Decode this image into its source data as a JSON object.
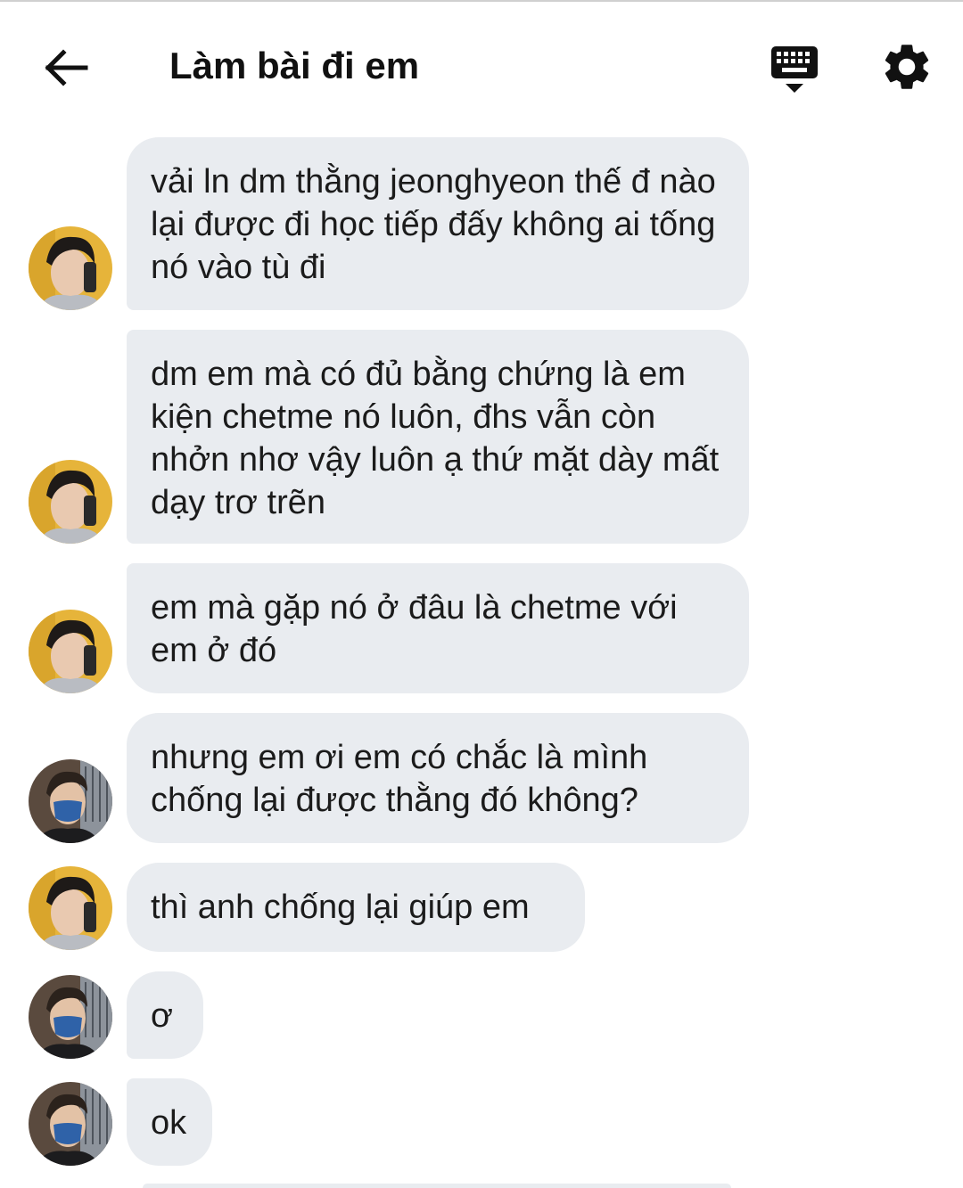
{
  "header": {
    "title": "Làm bài đi em",
    "back_icon": "arrow-left-icon",
    "keyboard_icon": "keyboard-icon",
    "settings_icon": "gear-icon"
  },
  "messages": [
    {
      "sender": "A",
      "text": "vải ln dm thằng jeonghyeon thế đ nào lại được đi học tiếp đấy không ai tống nó vào tù đi"
    },
    {
      "sender": "A",
      "text": "dm em mà có đủ bằng chứng là em kiện chetme nó luôn, đhs vẫn còn nhởn nhơ vậy luôn ạ thứ mặt dày mất dạy trơ trẽn"
    },
    {
      "sender": "A",
      "text": "em mà gặp nó ở đâu là chetme với em ở đó"
    },
    {
      "sender": "B",
      "text": "nhưng em ơi em có chắc là mình chống lại được thằng đó không?"
    },
    {
      "sender": "A",
      "text": "thì anh chống lại giúp em"
    },
    {
      "sender": "B",
      "text": "ơ"
    },
    {
      "sender": "B",
      "text": "ok"
    }
  ],
  "colors": {
    "bubble": "#e9ecf0",
    "text": "#1b1b1b"
  }
}
